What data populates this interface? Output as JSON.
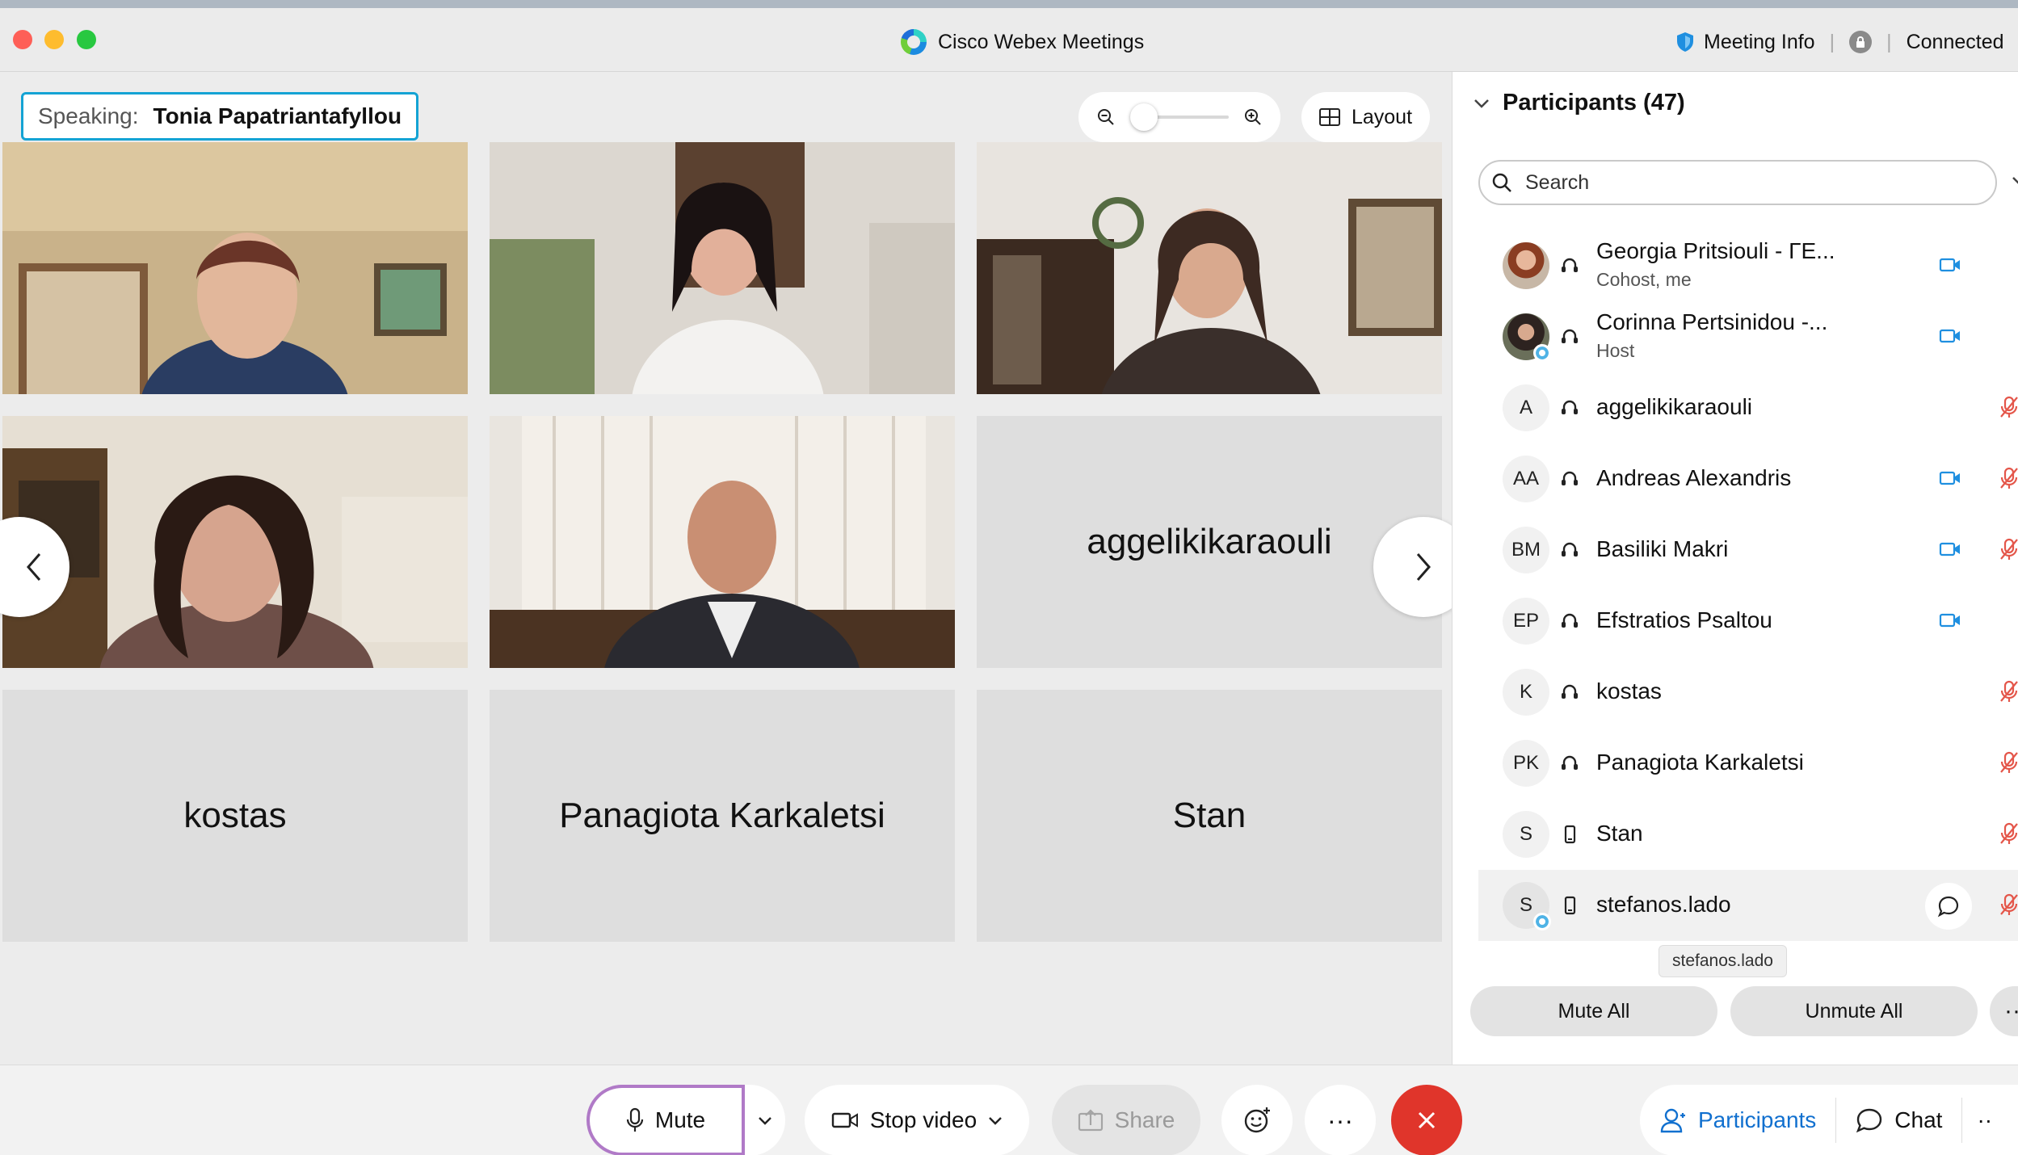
{
  "window": {
    "title": "Cisco Webex Meetings",
    "meeting_info": "Meeting Info",
    "connection_status": "Connected"
  },
  "stage": {
    "speaking_label": "Speaking:",
    "speaking_name": "Tonia Papatriantafyllou",
    "zoom_level": 0,
    "layout_label": "Layout",
    "name_tiles": [
      "aggelikikaraouli",
      "kostas",
      "Panagiota Karkaletsi",
      "Stan"
    ]
  },
  "panel": {
    "title": "Participants (47)",
    "search_placeholder": "Search",
    "participants": [
      {
        "name": "Georgia Pritsiouli - ΓΕ...",
        "role": "Cohost, me",
        "initials": "",
        "video": true,
        "muted": false
      },
      {
        "name": "Corinna Pertsinidou -...",
        "role": "Host",
        "initials": "",
        "video": true,
        "muted": false
      },
      {
        "name": "aggelikikaraouli",
        "role": "",
        "initials": "A",
        "video": false,
        "muted": true
      },
      {
        "name": "Andreas Alexandris",
        "role": "",
        "initials": "AA",
        "video": true,
        "muted": true
      },
      {
        "name": "Basiliki Makri",
        "role": "",
        "initials": "BM",
        "video": true,
        "muted": true
      },
      {
        "name": "Efstratios Psaltou",
        "role": "",
        "initials": "EP",
        "video": true,
        "muted": false
      },
      {
        "name": "kostas",
        "role": "",
        "initials": "K",
        "video": false,
        "muted": true
      },
      {
        "name": "Panagiota Karkaletsi",
        "role": "",
        "initials": "PK",
        "video": false,
        "muted": true
      },
      {
        "name": "Stan",
        "role": "",
        "initials": "S",
        "video": false,
        "muted": true
      },
      {
        "name": "stefanos.lado",
        "role": "",
        "initials": "S",
        "video": false,
        "muted": true
      }
    ],
    "tooltip": "stefanos.lado",
    "mute_all": "Mute All",
    "unmute_all": "Unmute All",
    "more": "···"
  },
  "controls": {
    "mute": "Mute",
    "stop_video": "Stop video",
    "share": "Share",
    "more": "···",
    "participants_tab": "Participants",
    "chat_tab": "Chat",
    "tabs_more": "··"
  },
  "colors": {
    "accent_blue": "#1170cf",
    "speaking_border": "#14a3d4",
    "leave_red": "#e0352b",
    "mute_icon_red": "#e4564a",
    "cam_icon_blue": "#1f8fe0",
    "focus_purple": "#b07ac7"
  }
}
